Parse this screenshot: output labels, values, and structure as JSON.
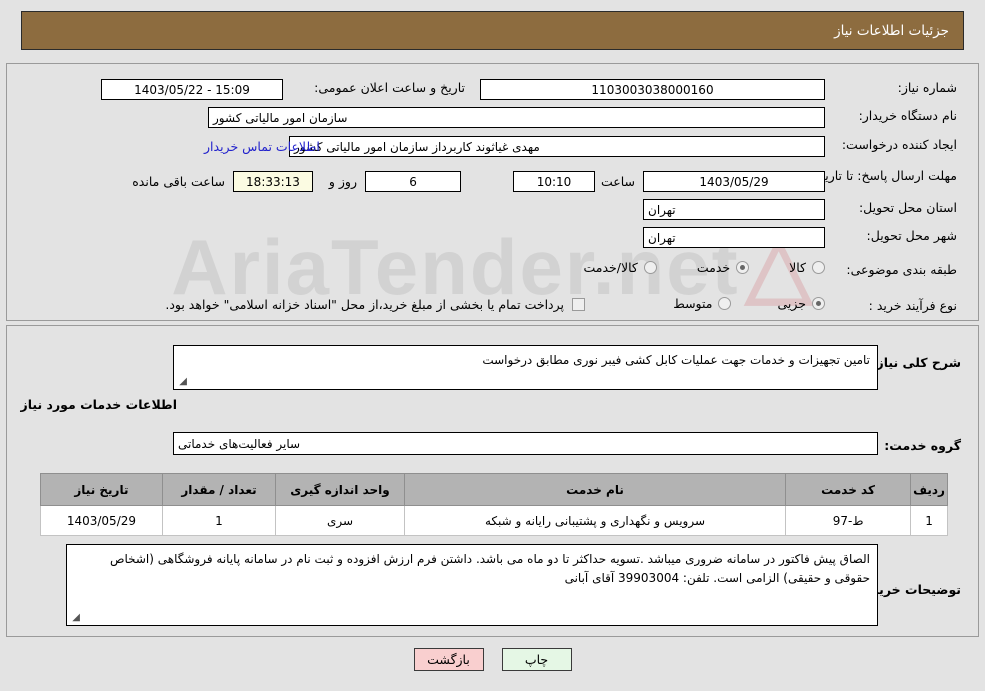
{
  "header": {
    "title": "جزئیات اطلاعات نیاز"
  },
  "watermark": {
    "text": "AriaTender.net"
  },
  "top_form": {
    "need_number": {
      "label": "شماره نیاز:",
      "value": "1103003038000160"
    },
    "announce_datetime": {
      "label": "تاریخ و ساعت اعلان عمومی:",
      "value": "15:09 - 1403/05/22"
    },
    "buyer_org": {
      "label": "نام دستگاه خریدار:",
      "value": "سازمان امور مالیاتی کشور"
    },
    "request_creator": {
      "label": "ایجاد کننده درخواست:",
      "value": "مهدی غیاثوند کاربرداز سازمان امور مالیاتی کشور"
    },
    "buyer_contact_link": "اطلاعات تماس خریدار",
    "deadline": {
      "label": "مهلت ارسال پاسخ: تا تاریخ:",
      "date": "1403/05/29",
      "time_label": "ساعت",
      "time": "10:10",
      "days": "6",
      "days_label": "روز و",
      "countdown": "18:33:13",
      "countdown_label": "ساعت باقی مانده"
    },
    "delivery_province": {
      "label": "استان محل تحویل:",
      "value": "تهران"
    },
    "delivery_city": {
      "label": "شهر محل تحویل:",
      "value": "تهران"
    },
    "category": {
      "label": "طبقه بندی موضوعی:",
      "options": [
        {
          "label": "کالا",
          "selected": false
        },
        {
          "label": "خدمت",
          "selected": true
        },
        {
          "label": "کالا/خدمت",
          "selected": false
        }
      ]
    },
    "purchase_process": {
      "label": "نوع فرآیند خرید :",
      "options": [
        {
          "label": "جزیی",
          "selected": true
        },
        {
          "label": "متوسط",
          "selected": false
        }
      ],
      "treasury_note": "پرداخت تمام یا بخشی از مبلغ خرید،از محل \"اسناد خزانه اسلامی\" خواهد بود.",
      "treasury_checked": false
    }
  },
  "bottom": {
    "general_desc": {
      "label": "شرح کلی نیاز:",
      "value": "تامین تجهیزات و خدمات جهت عملیات کابل کشی فیبر نوری مطابق درخواست"
    },
    "section_heading": "اطلاعات خدمات مورد نیاز",
    "service_group": {
      "label": "گروه خدمت:",
      "value": "سایر فعالیت‌های خدماتی"
    },
    "table": {
      "headers": [
        "ردیف",
        "کد خدمت",
        "نام خدمت",
        "واحد اندازه گیری",
        "تعداد / مقدار",
        "تاریخ نیاز"
      ],
      "rows": [
        {
          "radif": "1",
          "code": "ط-97",
          "name": "سرویس و نگهداری و پشتیبانی رایانه و شبکه",
          "unit": "سری",
          "qty": "1",
          "date": "1403/05/29"
        }
      ]
    },
    "buyer_notes": {
      "label": "توضیحات خریدار:",
      "value": "الصاق پیش فاکتور در سامانه ضروری میباشد .تسویه حداکثر تا دو ماه می باشد.  داشتن فرم ارزش افزوده و ثبت نام در سامانه پایانه فروشگاهی (اشخاص حقوقی و حقیقی) الزامی است. تلفن:  39903004 آقای آبانی"
    }
  },
  "buttons": {
    "print": "چاپ",
    "back": "بازگشت"
  },
  "colors": {
    "header_bg": "#8d6c3f",
    "page_bg": "#e3e3e3",
    "link": "#2222cc",
    "table_header_bg": "#b3b3b3",
    "btn_print_bg": "#e5f7e5",
    "btn_back_bg": "#f9cfcf",
    "countdown_bg": "#fbfbe2"
  }
}
